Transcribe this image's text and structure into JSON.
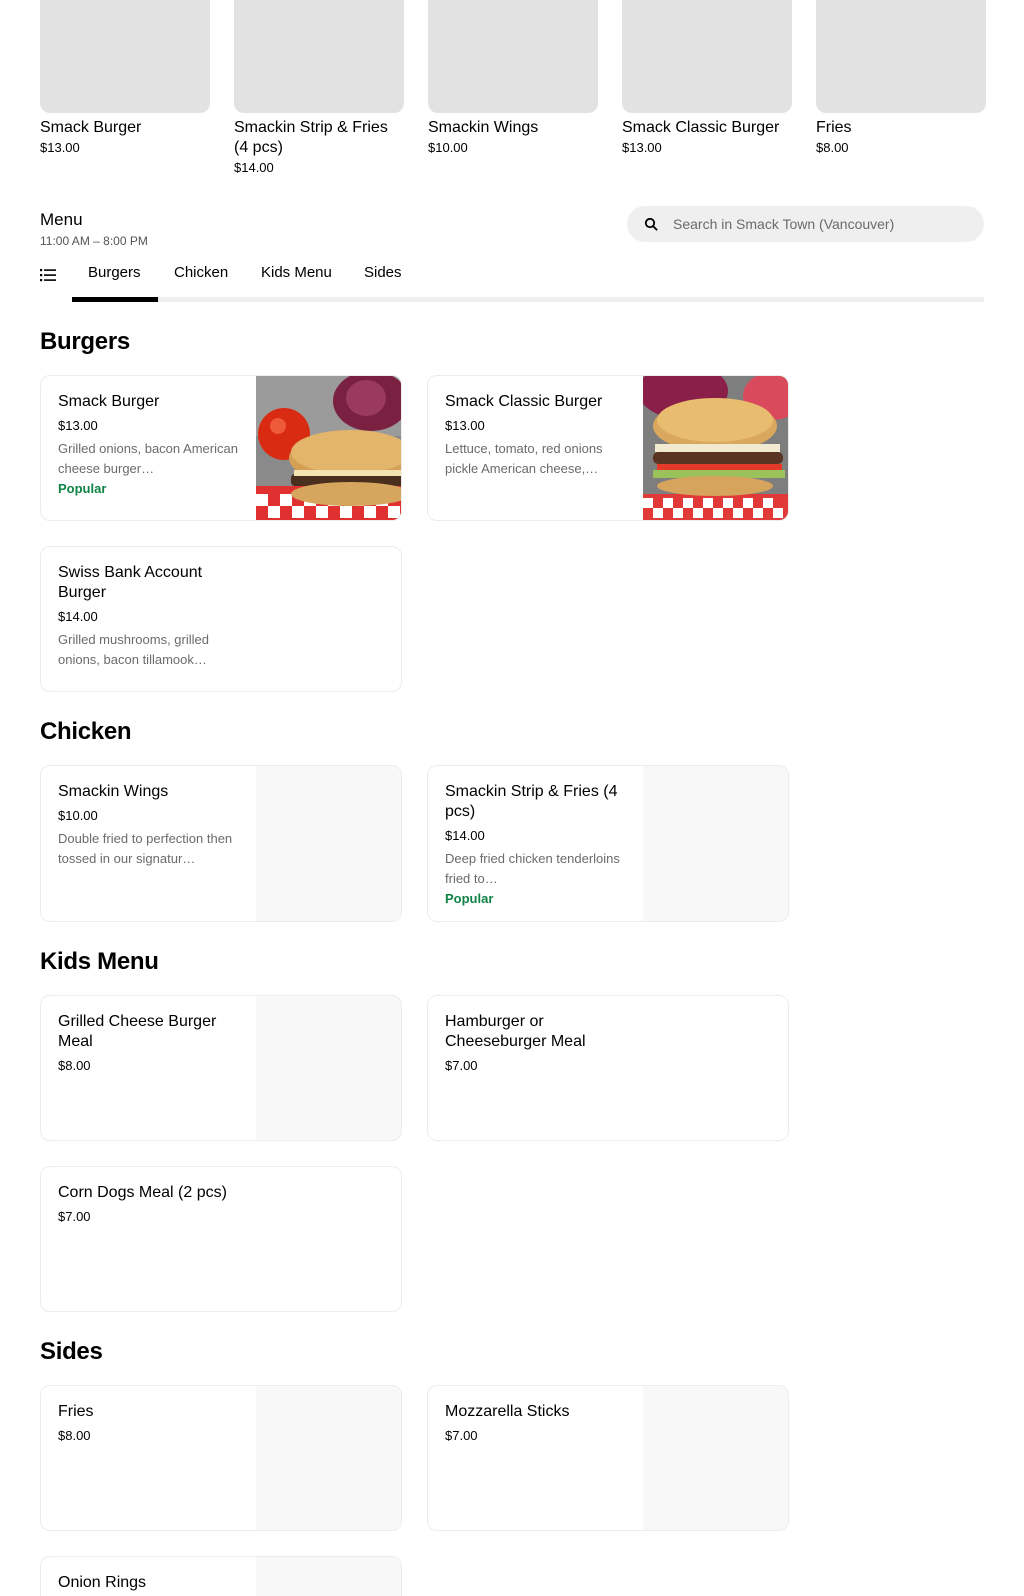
{
  "featured": [
    {
      "title": "Smack Burger",
      "price": "$13.00"
    },
    {
      "title": "Smackin Strip & Fries (4 pcs)",
      "price": "$14.00"
    },
    {
      "title": "Smackin Wings",
      "price": "$10.00"
    },
    {
      "title": "Smack Classic Burger",
      "price": "$13.00"
    },
    {
      "title": "Fries",
      "price": "$8.00"
    }
  ],
  "menu": {
    "title": "Menu",
    "hours": "11:00 AM – 8:00 PM"
  },
  "search": {
    "placeholder": "Search in Smack Town (Vancouver)"
  },
  "tabs": [
    {
      "label": "Burgers",
      "active": true
    },
    {
      "label": "Chicken"
    },
    {
      "label": "Kids Menu"
    },
    {
      "label": "Sides"
    }
  ],
  "sections": [
    {
      "title": "Burgers",
      "items": [
        {
          "title": "Smack Burger",
          "price": "$13.00",
          "desc": "Grilled onions, bacon American cheese burger…",
          "badge": "Popular"
        },
        {
          "title": "Smack Classic Burger",
          "price": "$13.00",
          "desc": "Lettuce, tomato, red onions pickle American cheese,…"
        },
        {
          "title": "Swiss Bank Account Burger",
          "price": "$14.00",
          "desc": "Grilled mushrooms, grilled onions, bacon tillamook…"
        }
      ]
    },
    {
      "title": "Chicken",
      "items": [
        {
          "title": "Smackin Wings",
          "price": "$10.00",
          "desc": "Double fried to perfection then tossed in our signatur…"
        },
        {
          "title": "Smackin Strip & Fries (4 pcs)",
          "price": "$14.00",
          "desc": "Deep fried chicken tenderloins fried to…",
          "badge": "Popular"
        }
      ]
    },
    {
      "title": "Kids Menu",
      "items": [
        {
          "title": "Grilled Cheese Burger Meal",
          "price": "$8.00"
        },
        {
          "title": "Hamburger or Cheeseburger Meal",
          "price": "$7.00"
        },
        {
          "title": "Corn Dogs Meal (2 pcs)",
          "price": "$7.00"
        }
      ]
    },
    {
      "title": "Sides",
      "items": [
        {
          "title": "Fries",
          "price": "$8.00"
        },
        {
          "title": "Mozzarella Sticks",
          "price": "$7.00"
        },
        {
          "title": "Onion Rings"
        }
      ]
    }
  ],
  "colors": {
    "accent": "#000000",
    "popular": "#0e8345",
    "tab_track": "#eeeeee",
    "placeholder_bg": "#e2e2e2"
  }
}
